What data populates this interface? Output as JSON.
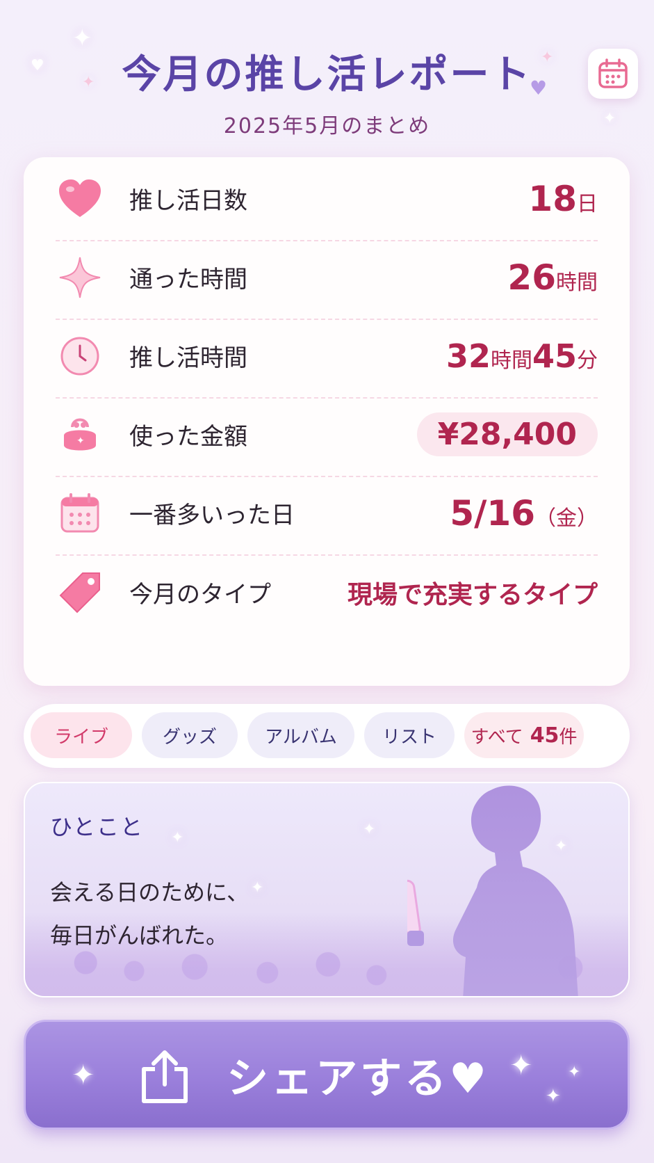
{
  "header": {
    "title": "今月の推し活レポート",
    "subtitle": "2025年5月のまとめ"
  },
  "stats": [
    {
      "icon": "heart-icon",
      "label": "推し活日数",
      "value": "18",
      "unit": "日"
    },
    {
      "icon": "sparkle-icon",
      "label": "通った時間",
      "value": "26",
      "unit": "時間"
    },
    {
      "icon": "clock-icon",
      "label": "推し活時間",
      "value": "32",
      "unit": "時間",
      "value2": "45",
      "unit2": "分"
    },
    {
      "icon": "purse-icon",
      "label": "使った金額",
      "value": "¥28,400"
    },
    {
      "icon": "calendar-icon",
      "label": "一番多いった日",
      "value": "5/16",
      "unit": "（金）"
    },
    {
      "icon": "tag-icon",
      "label": "今月のタイプ",
      "value": "現場で充実するタイプ"
    }
  ],
  "tabs": {
    "items": [
      "ライブ",
      "グッズ",
      "アルバム",
      "リスト"
    ],
    "active": "ライブ",
    "all_label": "すべて",
    "all_count": "45",
    "all_unit": "件"
  },
  "comment": {
    "heading": "ひとこと",
    "line1": "会える日のために、",
    "line2": "毎日がんばれた。"
  },
  "share": {
    "label": "シェアする♥"
  },
  "colors": {
    "accent": "#b0254f",
    "primary": "#9a7fdb",
    "title": "#5a44a6"
  }
}
